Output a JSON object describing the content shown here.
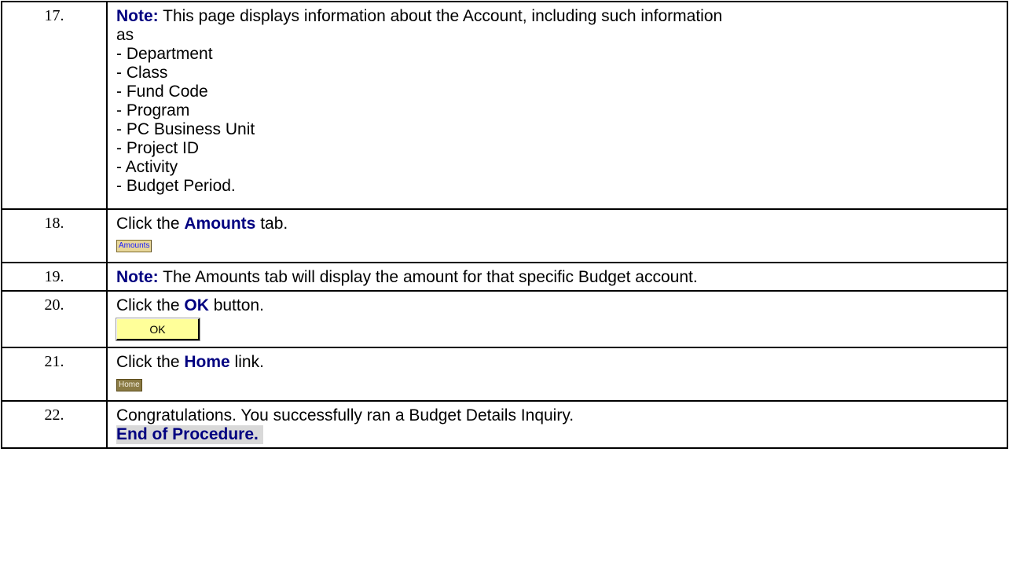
{
  "steps": [
    {
      "number": "17.",
      "lead": "Note:",
      "text": " This page displays information about the Account, including such information",
      "text2": "as",
      "items": [
        "- Department",
        "- Class",
        "- Fund Code",
        "- Program",
        "- PC Business Unit",
        "- Project ID",
        "- Activity",
        "- Budget Period."
      ]
    },
    {
      "number": "18.",
      "pre": "Click the ",
      "keyword": "Amounts",
      "post": " tab.",
      "control_label": "Amounts"
    },
    {
      "number": "19.",
      "lead": "Note:",
      "text": " The Amounts tab will display the amount for that specific Budget account."
    },
    {
      "number": "20.",
      "pre": "Click the ",
      "keyword": "OK",
      "post": " button.",
      "control_label": "OK"
    },
    {
      "number": "21.",
      "pre": "Click the ",
      "keyword": "Home",
      "post": " link.",
      "control_label": "Home"
    },
    {
      "number": "22.",
      "text": "Congratulations. You successfully ran a Budget Details Inquiry.",
      "end": "End of Procedure."
    }
  ],
  "colors": {
    "keyword": "#000080",
    "ok_button": "#ffff99",
    "amounts_tab": "#e8d79a",
    "home_link": "#8a7a44",
    "end_highlight": "#d9d9d9"
  },
  "icons": []
}
